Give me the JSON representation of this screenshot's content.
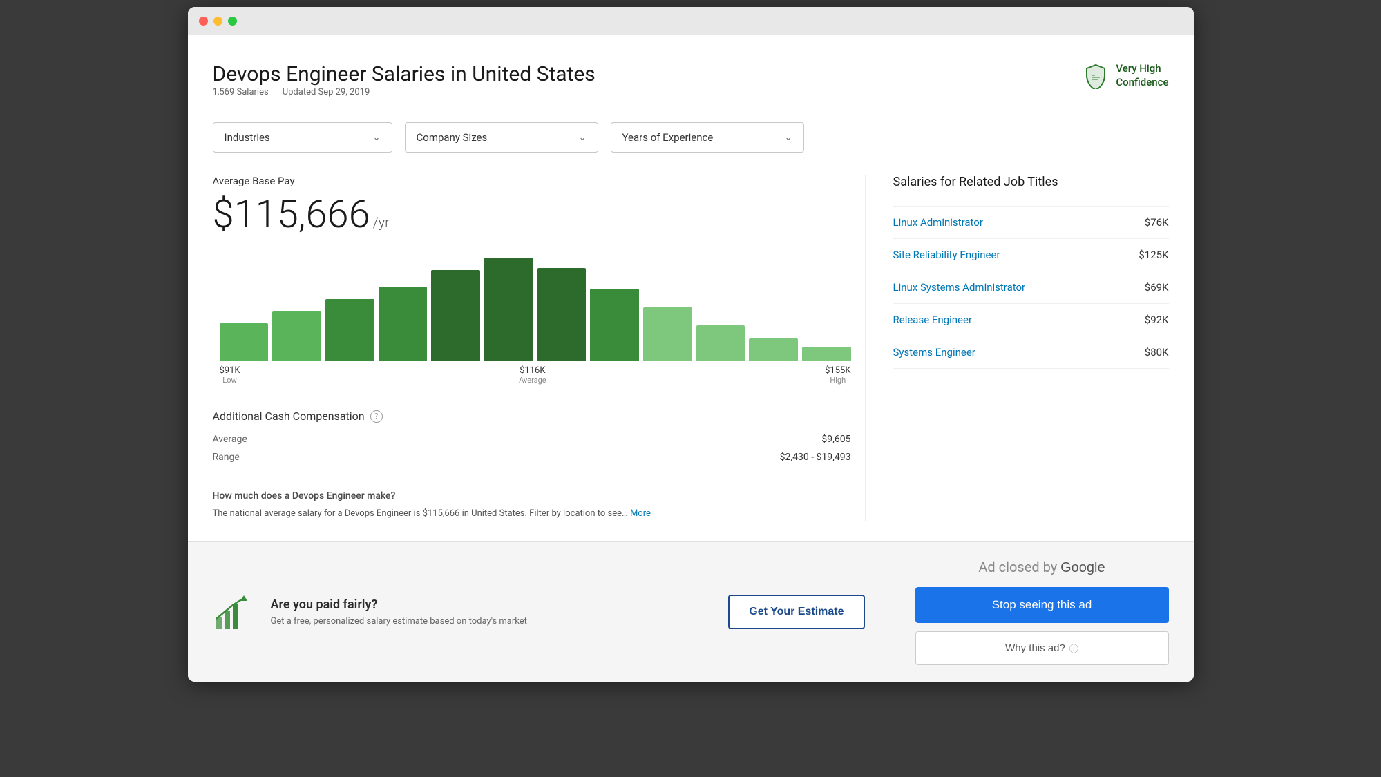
{
  "window": {
    "titlebar": {
      "dots": [
        "red",
        "yellow",
        "green"
      ]
    }
  },
  "header": {
    "title": "Devops Engineer Salaries in United States",
    "salaries_count": "1,569 Salaries",
    "updated": "Updated Sep 29, 2019",
    "confidence_label": "Very High\nConfidence"
  },
  "filters": {
    "industries_label": "Industries",
    "company_sizes_label": "Company Sizes",
    "experience_label": "Years of Experience"
  },
  "salary": {
    "avg_label": "Average Base Pay",
    "amount": "$115,666",
    "unit": "/yr",
    "histogram": {
      "low_label": "$91K",
      "low_desc": "Low",
      "avg_label": "$116K",
      "avg_desc": "Average",
      "high_label": "$155K",
      "high_desc": "High",
      "bars": [
        55,
        72,
        88,
        105,
        120,
        148,
        135,
        110,
        90,
        68,
        45,
        30
      ]
    }
  },
  "cash_comp": {
    "title": "Additional Cash Compensation",
    "average_label": "Average",
    "average_value": "$9,605",
    "range_label": "Range",
    "range_value": "$2,430 - $19,493"
  },
  "description": {
    "question": "How much does a Devops Engineer make?",
    "text": "The national average salary for a Devops Engineer is $115,666 in United States. Filter by location to see…",
    "more_label": "More"
  },
  "related": {
    "title": "Salaries for Related Job Titles",
    "items": [
      {
        "title": "Linux Administrator",
        "salary": "$76K"
      },
      {
        "title": "Site Reliability Engineer",
        "salary": "$125K"
      },
      {
        "title": "Linux Systems Administrator",
        "salary": "$69K"
      },
      {
        "title": "Release Engineer",
        "salary": "$92K"
      },
      {
        "title": "Systems Engineer",
        "salary": "$80K"
      }
    ]
  },
  "ad_banner": {
    "headline": "Are you paid fairly?",
    "subtext": "Get a free, personalized salary estimate based on today's market",
    "cta_label": "Get Your Estimate"
  },
  "google_ad": {
    "header": "Ad closed by Google",
    "stop_label": "Stop seeing this ad",
    "why_label": "Why this ad?"
  }
}
